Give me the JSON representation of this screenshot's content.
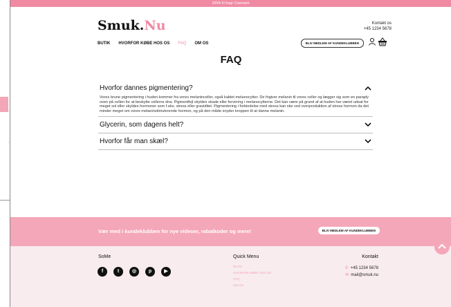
{
  "topbar": {
    "text": "100% fri fragt i Danmark"
  },
  "header": {
    "logo_main": "Smuk.",
    "logo_accent": "Nu",
    "contact_label": "Kontakt os",
    "contact_phone": "+45 1234 5678",
    "member_button": "BLIV MEDLEM AF KUNDEKLUBBEN"
  },
  "nav": [
    {
      "label": "BUTIK",
      "active": false
    },
    {
      "label": "HVORFOR KØBE HOS OS",
      "active": false
    },
    {
      "label": "FAQ",
      "active": true
    },
    {
      "label": "OM OS",
      "active": false
    }
  ],
  "faq": {
    "title": "FAQ",
    "items": [
      {
        "question": "Hvorfor dannes pigmentering?",
        "open": true,
        "answer": "Vores brune pigmentering i huden kommer fra vores melaninceller, også kaldet melanocytter. De frigiver melanin til vores celler og lægger sig som en paraply oven på cellen for at beskytte cellerns dna. Pigmentfejl skyldes skade eller forvirring i melanocytterne. Det kan være på grund af at huden har været udsat for meget sol eller skyldes hormoner som f.eks. stress eller graviditet. Pigmentering i forbindelse med stress kan ske ved overproduktion af stress hormon da det minder meget om vores melaninstimulerende hormon, og på den måde snyder kroppen til at danne melanin."
      },
      {
        "question": "Glycerin, som dagens helt?",
        "open": false
      },
      {
        "question": "Hvorfor får man skæl?",
        "open": false
      }
    ]
  },
  "newsletter": {
    "text": "Vær med i kundeklubben for nye videoer, rabatkoder og mere!",
    "button": "BLIV MEDLEM AF KUNDEKLUBBEN"
  },
  "footer": {
    "some_title": "SoMe",
    "social_icons": [
      "facebook-icon",
      "twitter-icon",
      "instagram-icon",
      "pinterest-icon",
      "youtube-icon"
    ],
    "quick_title": "Quick Menu",
    "quick_links": [
      "BUTIK",
      "HVORFOR KØBE HOS OS",
      "FAQ",
      "OM OS"
    ],
    "kontakt_title": "Kontakt",
    "phone": "+45 1234 5678",
    "email": "mail@smuk.nu"
  },
  "colors": {
    "accent": "#f08aa3",
    "newsletter_bg": "#f4a7b8",
    "footer_bg": "#f8ecef"
  }
}
